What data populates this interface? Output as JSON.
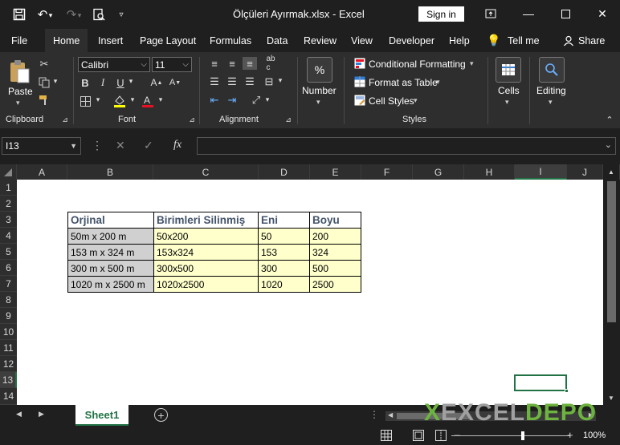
{
  "titlebar": {
    "doc_title": "Ölçüleri Ayırmak.xlsx  -  Excel",
    "signin": "Sign in"
  },
  "menu": {
    "tabs": [
      "File",
      "Home",
      "Insert",
      "Page Layout",
      "Formulas",
      "Data",
      "Review",
      "View",
      "Developer",
      "Help",
      "Tell me",
      "Share"
    ]
  },
  "ribbon": {
    "clipboard": {
      "paste": "Paste",
      "label": "Clipboard"
    },
    "font": {
      "family": "Calibri",
      "size": "11",
      "label": "Font"
    },
    "alignment": {
      "label": "Alignment"
    },
    "number": {
      "label": "Number",
      "icon_text": "%"
    },
    "styles": {
      "conditional": "Conditional Formatting",
      "format_table": "Format as Table",
      "cell_styles": "Cell Styles",
      "label": "Styles"
    },
    "cells": {
      "label": "Cells"
    },
    "editing": {
      "label": "Editing"
    }
  },
  "formula_bar": {
    "name_box": "I13",
    "fx": "fx",
    "formula": ""
  },
  "columns": [
    "A",
    "B",
    "C",
    "D",
    "E",
    "F",
    "G",
    "H",
    "I",
    "J"
  ],
  "rows": [
    "1",
    "2",
    "3",
    "4",
    "5",
    "6",
    "7",
    "8",
    "9",
    "10",
    "11",
    "12",
    "13",
    "14"
  ],
  "table": {
    "headers": [
      "Orjinal",
      "Birimleri Silinmiş",
      "Eni",
      "Boyu"
    ],
    "rows": [
      [
        "50m x 200 m",
        "50x200",
        "50",
        "200"
      ],
      [
        "153 m x 324 m",
        "153x324",
        "153",
        "324"
      ],
      [
        "300 m x 500 m",
        "300x500",
        "300",
        "500"
      ],
      [
        "1020 m x 2500 m",
        "1020x2500",
        "1020",
        "2500"
      ]
    ]
  },
  "sheet_tab": "Sheet1",
  "status": {
    "zoom": "100%"
  },
  "watermark": {
    "x": "X",
    "excel": "EXCEL",
    "depo": "DEPO"
  },
  "colors": {
    "accent": "#217346",
    "header_text": "#44546a",
    "yellow_fill": "#ffffcc",
    "gray_fill": "#d0d0d0"
  }
}
